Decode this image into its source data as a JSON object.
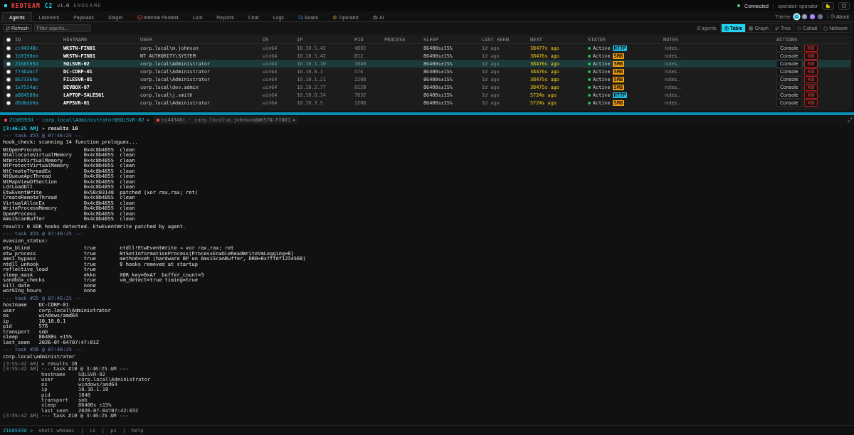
{
  "header": {
    "brand": "REDTEAM",
    "brand_accent": "C2",
    "version": "v1.0",
    "edition": "ENDGAME",
    "connection": {
      "label": "Connected",
      "on": true
    },
    "operator": "operator: operator"
  },
  "nav": {
    "tabs": [
      {
        "label": "Agents",
        "kind": "plain",
        "selected": true
      },
      {
        "label": "Listeners",
        "kind": "plain",
        "selected": false
      },
      {
        "label": "Payloads",
        "kind": "plain",
        "selected": false
      },
      {
        "label": "Stager",
        "kind": "plain",
        "selected": false
      },
      {
        "label": "Internal Pentest",
        "kind": "pentest",
        "selected": false
      },
      {
        "label": "Loot",
        "kind": "plain",
        "selected": false
      },
      {
        "label": "Reports",
        "kind": "plain",
        "selected": false
      },
      {
        "label": "Chat",
        "kind": "plain",
        "selected": false
      },
      {
        "label": "Logs",
        "kind": "plain",
        "selected": false
      },
      {
        "label": "Scans",
        "kind": "scans",
        "selected": false
      },
      {
        "label": "Operator",
        "kind": "operator",
        "selected": false
      },
      {
        "label": "AI",
        "kind": "ai",
        "selected": false
      }
    ],
    "theme": {
      "label": "Theme",
      "swatches": [
        {
          "color": "#22b8d8",
          "selected": true
        },
        {
          "color": "#8fa3c8",
          "selected": false
        },
        {
          "color": "#a78bfa",
          "selected": false
        },
        {
          "color": "#64748b",
          "selected": false
        }
      ]
    },
    "about": "About"
  },
  "toolbar": {
    "refresh": "Refresh",
    "filter": {
      "placeholder": "Filter agents..."
    },
    "count": "8 agents",
    "views": [
      {
        "label": "Table",
        "kind": "table",
        "selected": true
      },
      {
        "label": "Graph",
        "kind": "graph",
        "selected": false
      },
      {
        "label": "Tree",
        "kind": "tree",
        "selected": false
      },
      {
        "label": "Cobalt",
        "kind": "cobalt",
        "selected": false
      },
      {
        "label": "Network",
        "kind": "network",
        "selected": false
      }
    ]
  },
  "agents": {
    "select_all": {
      "checked": false
    },
    "columns": [
      "ID",
      "HOSTNAME",
      "USER",
      "OS",
      "IP",
      "PID",
      "PROCESS",
      "SLEEP",
      "LAST SEEN",
      "NEXT",
      "STATUS",
      "NOTES",
      "ACTIONS"
    ],
    "rows": [
      {
        "checked": false,
        "selected": false,
        "id": "cc44348c",
        "hostname": "WKSTN-FIN01",
        "user": "corp.local\\m.johnson",
        "os": "win64",
        "ip": "10.10.5.42",
        "pid": "4892",
        "sleep": "86400s±15%",
        "last_seen": "1d ago",
        "next": "38477s ago",
        "status": "Active",
        "transport": {
          "label": "HTTP",
          "color": "#22b8d8"
        },
        "placeholder": "notes...",
        "console": "Console",
        "kill": "Kill"
      },
      {
        "checked": false,
        "selected": false,
        "id": "1b0190ee",
        "hostname": "WKSTN-FIN01",
        "user": "NT AUTHORITY\\SYSTEM",
        "os": "win64",
        "ip": "10.10.5.42",
        "pid": "812",
        "sleep": "86400s±15%",
        "last_seen": "1d ago",
        "next": "38476s ago",
        "status": "Active",
        "transport": {
          "label": "SMB",
          "color": "#f59e0b"
        },
        "placeholder": "notes...",
        "console": "Console",
        "kill": "Kill"
      },
      {
        "checked": false,
        "selected": true,
        "id": "21b6593d",
        "hostname": "SQLSVR-02",
        "user": "corp.local\\Administrator",
        "os": "win64",
        "ip": "10.10.1.10",
        "pid": "1040",
        "sleep": "86400s±15%",
        "last_seen": "1d ago",
        "next": "38476s ago",
        "status": "Active",
        "transport": {
          "label": "SMB",
          "color": "#f59e0b"
        },
        "placeholder": "notes...",
        "console": "Console",
        "kill": "Kill"
      },
      {
        "checked": false,
        "selected": false,
        "id": "f73ba6cf",
        "hostname": "DC-CORP-01",
        "user": "corp.local\\Administrator",
        "os": "win64",
        "ip": "10.10.0.1",
        "pid": "576",
        "sleep": "86400s±15%",
        "last_seen": "1d ago",
        "next": "38476s ago",
        "status": "Active",
        "transport": {
          "label": "SMB",
          "color": "#f59e0b"
        },
        "placeholder": "notes...",
        "console": "Console",
        "kill": "Kill"
      },
      {
        "checked": false,
        "selected": false,
        "id": "8673364e",
        "hostname": "FILESVR-01",
        "user": "corp.local\\Administrator",
        "os": "win64",
        "ip": "10.10.1.21",
        "pid": "2208",
        "sleep": "86400s±15%",
        "last_seen": "1d ago",
        "next": "38475s ago",
        "status": "Active",
        "transport": {
          "label": "SMB",
          "color": "#f59e0b"
        },
        "placeholder": "notes...",
        "console": "Console",
        "kill": "Kill"
      },
      {
        "checked": false,
        "selected": false,
        "id": "1e7534ac",
        "hostname": "DEVBOX-07",
        "user": "corp.local\\dev.admin",
        "os": "win64",
        "ip": "10.10.2.77",
        "pid": "9120",
        "sleep": "86400s±15%",
        "last_seen": "1d ago",
        "next": "38475s ago",
        "status": "Active",
        "transport": {
          "label": "SMB",
          "color": "#f59e0b"
        },
        "placeholder": "notes...",
        "console": "Console",
        "kill": "Kill"
      },
      {
        "checked": false,
        "selected": false,
        "id": "a884580a",
        "hostname": "LAPTOP-SALES01",
        "user": "corp.local\\j.smith",
        "os": "win64",
        "ip": "10.10.8.14",
        "pid": "7832",
        "sleep": "86400s±15%",
        "last_seen": "1d ago",
        "next": "5724s ago",
        "status": "Active",
        "transport": {
          "label": "HTTP",
          "color": "#22b8d8"
        },
        "placeholder": "notes...",
        "console": "Console",
        "kill": "Kill"
      },
      {
        "checked": false,
        "selected": false,
        "id": "d6d6db9a",
        "hostname": "APPSVR-01",
        "user": "corp.local\\Administrator",
        "os": "win64",
        "ip": "10.10.3.5",
        "pid": "1208",
        "sleep": "86400s±15%",
        "last_seen": "1d ago",
        "next": "5724s ago",
        "status": "Active",
        "transport": {
          "label": "SMB",
          "color": "#f59e0b"
        },
        "placeholder": "notes...",
        "console": "Console",
        "kill": "Kill"
      }
    ]
  },
  "terminal": {
    "tabs": [
      {
        "label": "21b6593d · corp.local\\Administrator@SQLSVR-02",
        "close": "×",
        "selected": true
      },
      {
        "label": "cc44348c · corp.local\\m.johnson@WKSTN-FIN01",
        "close": "×",
        "selected": false
      }
    ],
    "output": [
      {
        "kind": "result_header",
        "time": "[3:46:25 AM]",
        "arrow": "»",
        "label": "results 10"
      },
      {
        "kind": "task",
        "text": "--- task #23 @ 07:46:25 ---"
      },
      {
        "kind": "text",
        "text": "hook_check: scanning 14 function prologues..."
      },
      {
        "kind": "table",
        "rows": [
          [
            "NtOpenProcess",
            "0x4c8b4855",
            "clean"
          ],
          [
            "NtAllocateVirtualMemory",
            "0x4c8b4855",
            "clean"
          ],
          [
            "NtWriteVirtualMemory",
            "0x4c8b4855",
            "clean"
          ],
          [
            "NtProtectVirtualMemory",
            "0x4c8b4855",
            "clean"
          ],
          [
            "NtCreateThreadEx",
            "0x4c8b4855",
            "clean"
          ],
          [
            "NtQueueApcThread",
            "0x4c8b4855",
            "clean"
          ],
          [
            "NtMapViewOfSection",
            "0x4c8b4855",
            "clean"
          ],
          [
            "LdrLoadDll",
            "0x4c8b4855",
            "clean"
          ],
          [
            "EtwEventWrite",
            "0x58c03148",
            "patched (xor rax,rax; ret)"
          ],
          [
            "CreateRemoteThread",
            "0x4c8b4855",
            "clean"
          ],
          [
            "VirtualAllocEx",
            "0x4c8b4855",
            "clean"
          ],
          [
            "WriteProcessMemory",
            "0x4c8b4855",
            "clean"
          ],
          [
            "OpenProcess",
            "0x4c8b4855",
            "clean"
          ],
          [
            "AmsiScanBuffer",
            "0x4c8b4855",
            "clean"
          ]
        ]
      },
      {
        "kind": "text",
        "text": "result: 0 EDR hooks detected. EtwEventWrite patched by agent."
      },
      {
        "kind": "task",
        "text": "--- task #24 @ 07:46:25 ---"
      },
      {
        "kind": "text",
        "text": "evasion_status:"
      },
      {
        "kind": "table",
        "rows": [
          [
            "etw_blind",
            "true",
            "ntdll!EtwEventWrite → xor rax,rax; ret"
          ],
          [
            "etw_process",
            "true",
            "NtSetInformationProcess(ProcessEnableReadWriteVmLogging=0)"
          ],
          [
            "amsi_bypass",
            "true",
            "method=veh (hardware BP on AmsiScanBuffer, DR0=0x7ffdf1234560)"
          ],
          [
            "ntdll_unhook",
            "true",
            "0 hooks removed at startup"
          ],
          [
            "reflective_load",
            "true"
          ],
          [
            "sleep_mask",
            "ekko",
            "XOR key=0xA7  buffer_count=3"
          ],
          [
            "sandbox_checks",
            "true",
            "vm_detect=true timing=true"
          ],
          [
            "kill_date",
            "none"
          ],
          [
            "working_hours",
            "none"
          ]
        ]
      },
      {
        "kind": "task",
        "text": "--- task #25 @ 07:46:25 ---"
      },
      {
        "kind": "table",
        "rows": [
          [
            "hostname",
            "DC-CORP-01"
          ],
          [
            "user",
            "corp.local\\Administrator"
          ],
          [
            "os",
            "windows/amd64"
          ],
          [
            "ip",
            "10.10.0.1"
          ],
          [
            "pid",
            "576"
          ],
          [
            "transport",
            "smb"
          ],
          [
            "sleep",
            "86400s ±15%"
          ],
          [
            "last_seen",
            "2026-07-04T07:47:01Z"
          ]
        ]
      },
      {
        "kind": "task",
        "text": "--- task #26 @ 07:46:25 ---"
      },
      {
        "kind": "text",
        "text": "corp.local\\administrator"
      },
      {
        "kind": "log",
        "time": "[3:55:42 AM]",
        "text": "» results 20"
      },
      {
        "kind": "log",
        "time": "[3:55:42 AM]",
        "text": "--- task #10 @ 3:46:25 AM ---",
        "rows": [
          [
            "hostname",
            "SQLSVR-02"
          ],
          [
            "user",
            "corp.local\\Administrator"
          ],
          [
            "os",
            "windows/amd64"
          ],
          [
            "ip",
            "10.10.1.10"
          ],
          [
            "pid",
            "1040"
          ],
          [
            "transport",
            "smb"
          ],
          [
            "sleep",
            "86400s ±15%"
          ],
          [
            "last_seen",
            "2026-07-04T07:42:03Z"
          ]
        ]
      },
      {
        "kind": "log",
        "time": "[3:55:42 AM]",
        "text": "--- task #10 @ 3:46:25 AM ---"
      }
    ],
    "prompt": "21b6593d »",
    "input": {
      "placeholder": "shell whoami  |  ls  |  ps  |  help"
    }
  }
}
